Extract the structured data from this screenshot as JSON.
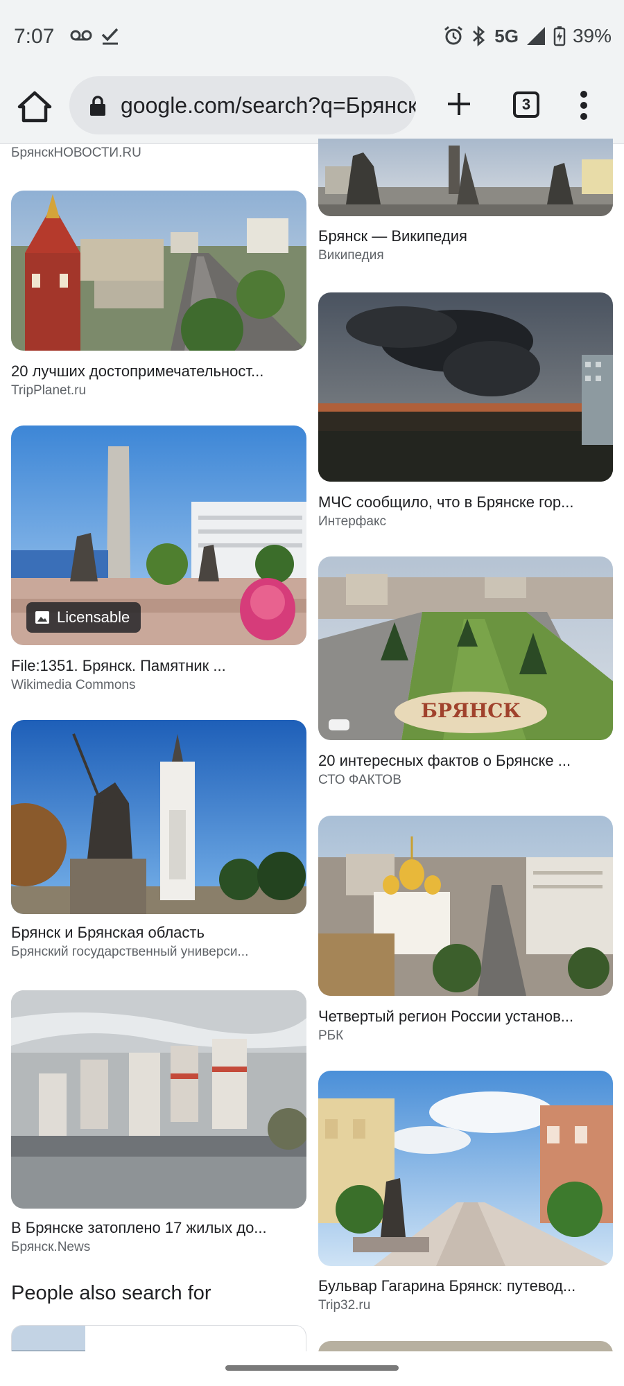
{
  "status_bar": {
    "time": "7:07",
    "network": "5G",
    "battery": "39%",
    "icons": [
      "voicemail-icon",
      "check-icon",
      "alarm-icon",
      "bluetooth-icon",
      "signal-icon",
      "battery-icon"
    ]
  },
  "toolbar": {
    "url": "google.com/search?q=Брянск",
    "tab_count": "3",
    "icons": [
      "home-icon",
      "lock-icon",
      "plus-icon",
      "tabs-icon",
      "more-vert-icon"
    ]
  },
  "results": {
    "top_source": "БрянскНОВОСТИ.RU",
    "left": [
      {
        "title": "20 лучших достопримечательност...",
        "source": "TripPlanet.ru"
      },
      {
        "title": "File:1351. Брянск. Памятник ...",
        "source": "Wikimedia Commons",
        "badge": "Licensable"
      },
      {
        "title": "Брянск и Брянская область",
        "source": "Брянский государственный универси..."
      },
      {
        "title": "В Брянске затоплено 17 жилых до...",
        "source": "Брянск.News"
      }
    ],
    "right": [
      {
        "title": "Брянск — Википедия",
        "source": "Википедия"
      },
      {
        "title": "МЧС сообщило, что в Брянске гор...",
        "source": "Интерфакс"
      },
      {
        "title": "20 интересных фактов о Брянске ...",
        "source": "СТО ФАКТОВ"
      },
      {
        "title": "Четвертый регион России установ...",
        "source": "РБК"
      },
      {
        "title": "Бульвар Гагарина Брянск: путевод...",
        "source": "Trip32.ru"
      }
    ]
  },
  "image_texts": {
    "flowerbed": "БРЯНСК"
  },
  "people_also_search": {
    "heading": "People also search for"
  },
  "colors": {
    "chrome_bg": "#f1f3f4",
    "url_pill": "#e3e5e8",
    "text_primary": "#202124",
    "text_secondary": "#5f6368"
  }
}
